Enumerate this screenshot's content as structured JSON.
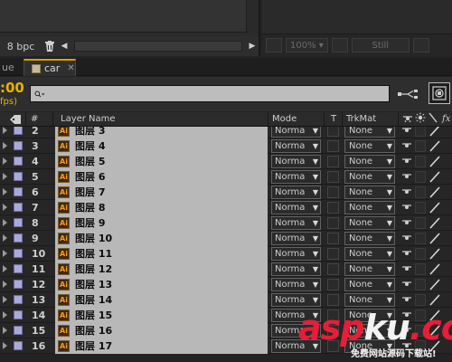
{
  "project_panel": {
    "bpc_label": "8 bpc"
  },
  "viewer": {
    "zoom": "100%",
    "quality": "Still"
  },
  "tabs": {
    "previous_tab_fragment": "ue",
    "active_tab": "car"
  },
  "composition": {
    "timecode": ":00",
    "fps": "fps)"
  },
  "columns": {
    "number": "#",
    "layer_name": "Layer Name",
    "mode": "Mode",
    "track_t": "T",
    "trkmat": "TrkMat"
  },
  "layers": [
    {
      "index": "2",
      "name": "图层 3",
      "mode": "Norma",
      "trkmat": "None"
    },
    {
      "index": "3",
      "name": "图层 4",
      "mode": "Norma",
      "trkmat": "None"
    },
    {
      "index": "4",
      "name": "图层 5",
      "mode": "Norma",
      "trkmat": "None"
    },
    {
      "index": "5",
      "name": "图层 6",
      "mode": "Norma",
      "trkmat": "None"
    },
    {
      "index": "6",
      "name": "图层 7",
      "mode": "Norma",
      "trkmat": "None"
    },
    {
      "index": "7",
      "name": "图层 8",
      "mode": "Norma",
      "trkmat": "None"
    },
    {
      "index": "8",
      "name": "图层 9",
      "mode": "Norma",
      "trkmat": "None"
    },
    {
      "index": "9",
      "name": "图层 10",
      "mode": "Norma",
      "trkmat": "None"
    },
    {
      "index": "10",
      "name": "图层 11",
      "mode": "Norma",
      "trkmat": "None"
    },
    {
      "index": "11",
      "name": "图层 12",
      "mode": "Norma",
      "trkmat": "None"
    },
    {
      "index": "12",
      "name": "图层 13",
      "mode": "Norma",
      "trkmat": "None"
    },
    {
      "index": "13",
      "name": "图层 14",
      "mode": "Norma",
      "trkmat": "None"
    },
    {
      "index": "14",
      "name": "图层 15",
      "mode": "Norma",
      "trkmat": "None"
    },
    {
      "index": "15",
      "name": "图层 16",
      "mode": "Norma",
      "trkmat": "None"
    },
    {
      "index": "16",
      "name": "图层 17",
      "mode": "Norma",
      "trkmat": "None"
    }
  ],
  "layer_icon_glyph": "Ai",
  "watermark": {
    "main_a": "asp",
    "main_b": "ku",
    "main_c": ".com",
    "sub": "免费网站源码下载站!"
  },
  "colors": {
    "accent_timecode": "#e8b200",
    "layer_label": "#a9aad8",
    "name_cell": "#b8b8b8",
    "watermark_red": "#e81d38"
  }
}
